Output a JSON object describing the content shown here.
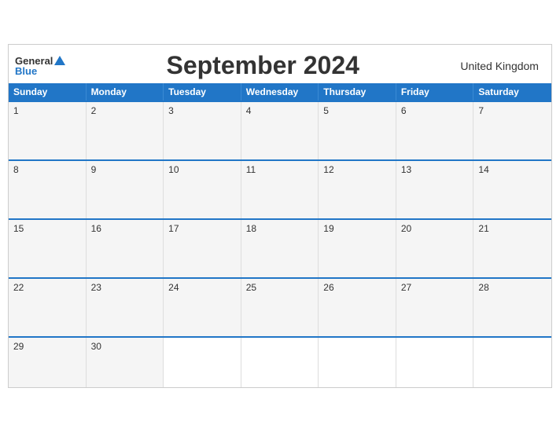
{
  "header": {
    "logo_general": "General",
    "logo_blue": "Blue",
    "title": "September 2024",
    "country": "United Kingdom"
  },
  "days_of_week": [
    "Sunday",
    "Monday",
    "Tuesday",
    "Wednesday",
    "Thursday",
    "Friday",
    "Saturday"
  ],
  "weeks": [
    [
      {
        "num": "1",
        "empty": false
      },
      {
        "num": "2",
        "empty": false
      },
      {
        "num": "3",
        "empty": false
      },
      {
        "num": "4",
        "empty": false
      },
      {
        "num": "5",
        "empty": false
      },
      {
        "num": "6",
        "empty": false
      },
      {
        "num": "7",
        "empty": false
      }
    ],
    [
      {
        "num": "8",
        "empty": false
      },
      {
        "num": "9",
        "empty": false
      },
      {
        "num": "10",
        "empty": false
      },
      {
        "num": "11",
        "empty": false
      },
      {
        "num": "12",
        "empty": false
      },
      {
        "num": "13",
        "empty": false
      },
      {
        "num": "14",
        "empty": false
      }
    ],
    [
      {
        "num": "15",
        "empty": false
      },
      {
        "num": "16",
        "empty": false
      },
      {
        "num": "17",
        "empty": false
      },
      {
        "num": "18",
        "empty": false
      },
      {
        "num": "19",
        "empty": false
      },
      {
        "num": "20",
        "empty": false
      },
      {
        "num": "21",
        "empty": false
      }
    ],
    [
      {
        "num": "22",
        "empty": false
      },
      {
        "num": "23",
        "empty": false
      },
      {
        "num": "24",
        "empty": false
      },
      {
        "num": "25",
        "empty": false
      },
      {
        "num": "26",
        "empty": false
      },
      {
        "num": "27",
        "empty": false
      },
      {
        "num": "28",
        "empty": false
      }
    ],
    [
      {
        "num": "29",
        "empty": false
      },
      {
        "num": "30",
        "empty": false
      },
      {
        "num": "",
        "empty": true
      },
      {
        "num": "",
        "empty": true
      },
      {
        "num": "",
        "empty": true
      },
      {
        "num": "",
        "empty": true
      },
      {
        "num": "",
        "empty": true
      }
    ]
  ],
  "colors": {
    "header_blue": "#2176c7",
    "border": "#2176c7",
    "cell_bg": "#f5f5f5",
    "empty_bg": "#ffffff"
  }
}
